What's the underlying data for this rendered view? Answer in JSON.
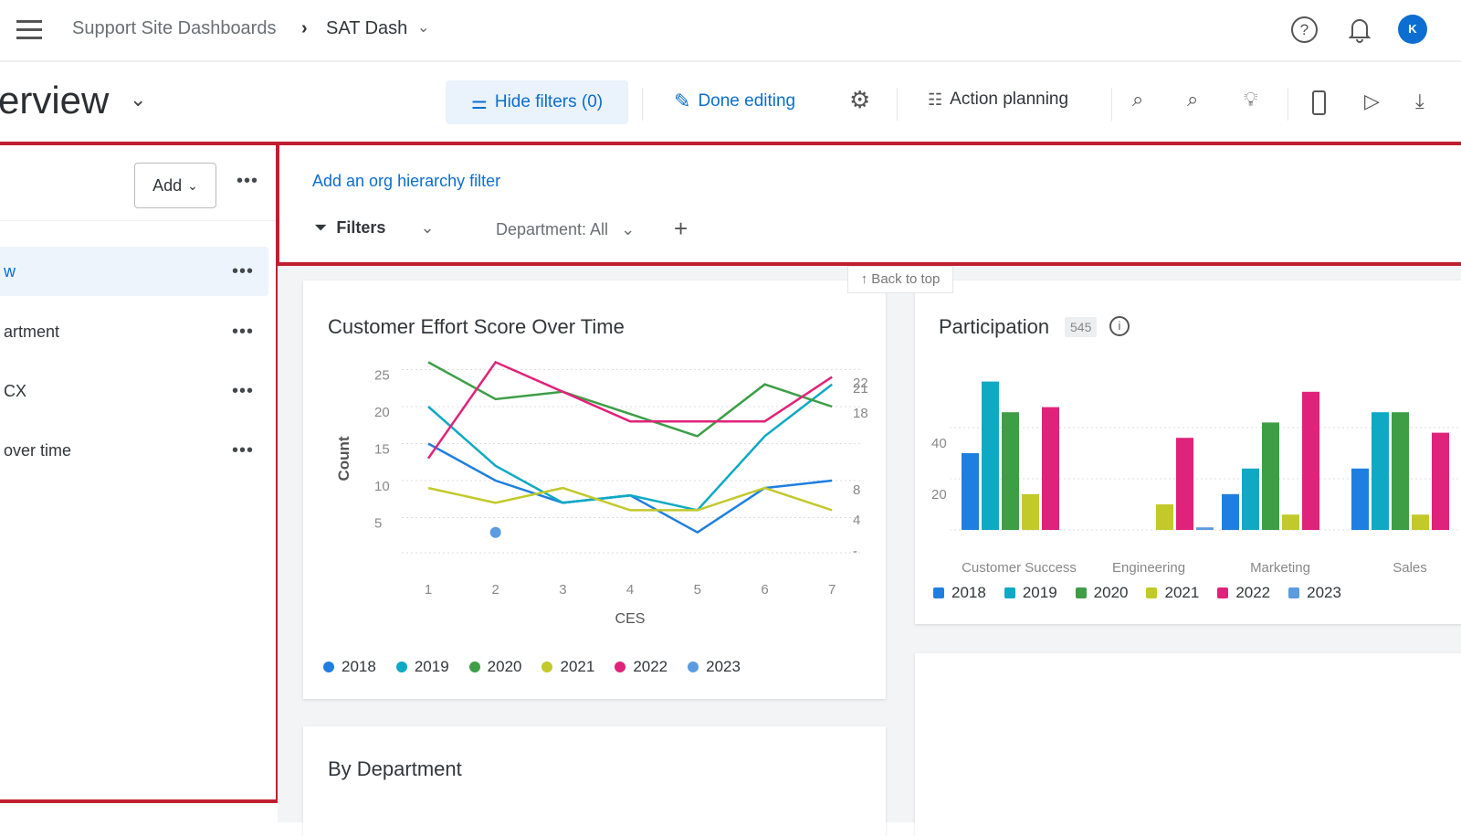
{
  "topbar": {
    "breadcrumb_parent": "Support Site Dashboards",
    "breadcrumb_sep": "›",
    "breadcrumb_current": "SAT Dash",
    "avatar_initial": "K",
    "icons": [
      "menu-icon",
      "help-icon",
      "bell-icon",
      "avatar"
    ]
  },
  "titlebar": {
    "page_title": "erview",
    "hide_filters": "Hide filters (0)",
    "done_editing": "Done editing",
    "action_planning": "Action planning"
  },
  "sidebar": {
    "add_label": "Add",
    "items": [
      {
        "label": "w",
        "active": true
      },
      {
        "label": "artment"
      },
      {
        "label": "CX"
      },
      {
        "label": "over time"
      }
    ]
  },
  "filters": {
    "org_link": "Add an org hierarchy filter",
    "filters_label": "Filters",
    "department": "Department: All",
    "back_to_top": "↑ Back to top"
  },
  "colors": {
    "2018": "#1f7fe0",
    "2019": "#0fa9c4",
    "2020": "#3d9e46",
    "2021": "#c2c92b",
    "2022": "#e0237a",
    "2023": "#5b9be0",
    "accent": "#0b6ed0",
    "highlight": "#c01f2f"
  },
  "chart_data": [
    {
      "type": "line",
      "title": "Customer Effort Score Over Time",
      "xlabel": "CES",
      "ylabel": "Count",
      "x": [
        1,
        2,
        3,
        4,
        5,
        6,
        7
      ],
      "ylim": [
        0,
        27
      ],
      "yticks": [
        5,
        10,
        15,
        20,
        25
      ],
      "grid": true,
      "legend": "bottom",
      "series": [
        {
          "name": "2018",
          "values": [
            15,
            10,
            7,
            8,
            3,
            9,
            10
          ]
        },
        {
          "name": "2019",
          "values": [
            20,
            12,
            7,
            8,
            6,
            16,
            23
          ]
        },
        {
          "name": "2020",
          "values": [
            26,
            21,
            22,
            19,
            16,
            23,
            20
          ]
        },
        {
          "name": "2021",
          "values": [
            9,
            7,
            9,
            6,
            6,
            9,
            6
          ]
        },
        {
          "name": "2022",
          "values": [
            13,
            26,
            22,
            18,
            18,
            18,
            24
          ]
        },
        {
          "name": "2023",
          "values": [
            null,
            3,
            null,
            null,
            null,
            null,
            null
          ]
        }
      ],
      "end_labels": [
        "22",
        "21",
        "18",
        "8",
        "4",
        "-"
      ]
    },
    {
      "type": "bar",
      "title": "Participation",
      "badge": "545",
      "categories": [
        "Customer Success",
        "Engineering",
        "Marketing",
        "Sales"
      ],
      "ylim": [
        0,
        60
      ],
      "yticks": [
        20,
        40
      ],
      "grid": true,
      "legend": "bottom",
      "series": [
        {
          "name": "2018",
          "values": [
            30,
            0,
            14,
            24
          ]
        },
        {
          "name": "2019",
          "values": [
            58,
            0,
            24,
            46
          ]
        },
        {
          "name": "2020",
          "values": [
            46,
            0,
            42,
            46
          ]
        },
        {
          "name": "2021",
          "values": [
            14,
            10,
            6,
            6
          ]
        },
        {
          "name": "2022",
          "values": [
            48,
            36,
            54,
            38
          ]
        },
        {
          "name": "2023",
          "values": [
            0,
            1,
            0,
            0
          ]
        }
      ]
    }
  ],
  "cards": {
    "by_department": "By Department"
  }
}
